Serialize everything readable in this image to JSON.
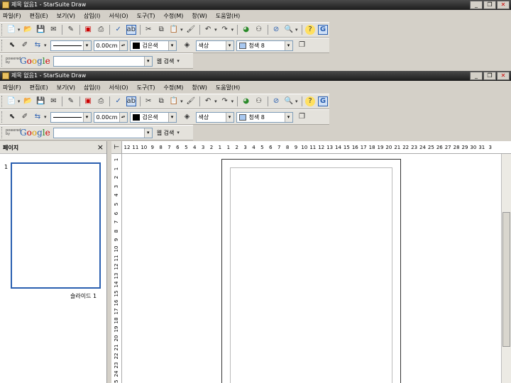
{
  "window": {
    "title": "제목 없음1 - StarSuite Draw",
    "buttons": {
      "minimize": "_",
      "restore": "❐",
      "close": "✕"
    }
  },
  "menu": [
    "파일(F)",
    "편집(E)",
    "보기(V)",
    "삽입(I)",
    "서식(O)",
    "도구(T)",
    "수정(M)",
    "창(W)",
    "도움말(H)"
  ],
  "toolbar": {
    "line_width": "0.00cm",
    "line_color": "검은색",
    "line_color_hex": "#000000",
    "area_style": "색상",
    "area_color": "청색 8",
    "area_color_hex": "#a8c8f0"
  },
  "google_bar": {
    "powered_by": "powered by",
    "logo": "Google",
    "search_value": "",
    "search_button": "웹 검색"
  },
  "sidebar": {
    "title": "페이지",
    "close": "×",
    "page_number": "1",
    "slide_label": "슬라이드 1"
  },
  "hruler": {
    "labels": [
      "12",
      "11",
      "10",
      "9",
      "8",
      "7",
      "6",
      "5",
      "4",
      "3",
      "2",
      "1",
      "1",
      "2",
      "3",
      "4",
      "5",
      "6",
      "7",
      "8",
      "9",
      "10",
      "11",
      "12",
      "13",
      "14",
      "15",
      "16",
      "17",
      "18",
      "19",
      "20",
      "21",
      "22",
      "23",
      "24",
      "25",
      "26",
      "27",
      "28",
      "29",
      "30",
      "31",
      "3"
    ]
  },
  "vruler": {
    "labels": [
      "1",
      "1",
      "2",
      "3",
      "4",
      "5",
      "6",
      "7",
      "8",
      "9",
      "10",
      "11",
      "12",
      "13",
      "14",
      "15",
      "16",
      "17",
      "18",
      "19",
      "20",
      "21",
      "22",
      "23",
      "24",
      "25"
    ]
  }
}
